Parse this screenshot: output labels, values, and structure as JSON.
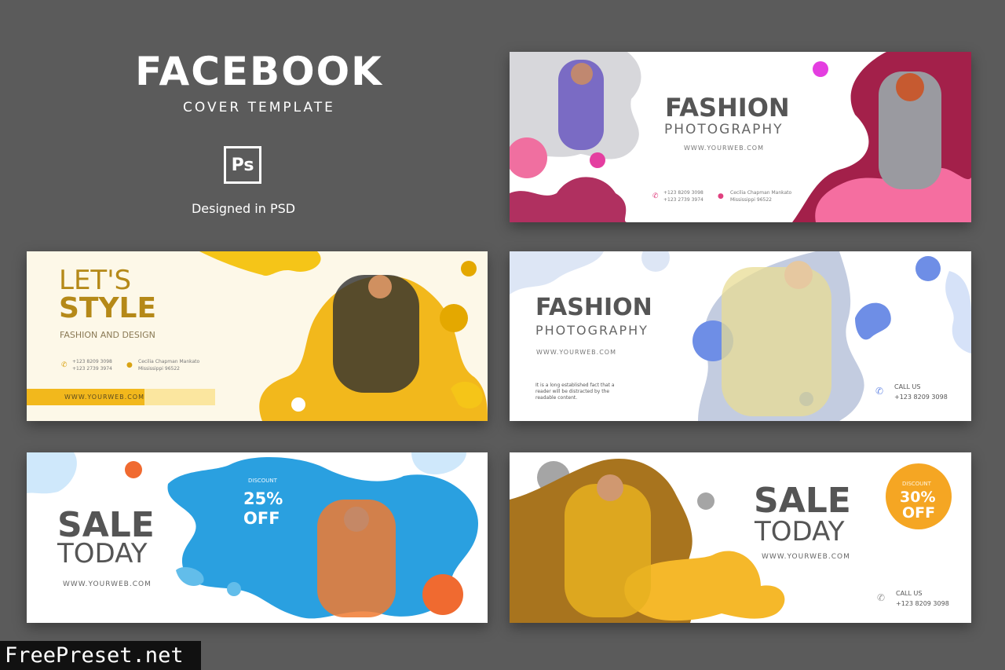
{
  "header": {
    "title": "FACEBOOK",
    "subtitle": "COVER TEMPLATE",
    "ps_label": "Ps",
    "note": "Designed in PSD"
  },
  "cards": {
    "fashion1": {
      "title": "FASHION",
      "subtitle": "PHOTOGRAPHY",
      "url": "WWW.YOURWEB.COM",
      "phone1": "+123 8209 3098",
      "phone2": "+123 2739 3974",
      "addr1": "Cecilia Chapman Mankato",
      "addr2": "Mississippi 96522",
      "accent": "#e0407f"
    },
    "style": {
      "line1": "LET'S",
      "line2": "STYLE",
      "tagline": "FASHION AND DESIGN",
      "phone1": "+123 8209 3098",
      "phone2": "+123 2739 3974",
      "addr1": "Cecilia Chapman Mankato",
      "addr2": "Mississippi 96522",
      "url": "WWW.YOURWEB.COM",
      "accent": "#f2b81c"
    },
    "fashion2": {
      "title": "FASHION",
      "subtitle": "PHOTOGRAPHY",
      "url": "WWW.YOURWEB.COM",
      "body1": "It is a long established fact that a",
      "body2": "reader will be distracted by the",
      "body3": "readable content.",
      "call_label": "CALL US",
      "call_number": "+123 8209 3098",
      "accent": "#6e8ee6"
    },
    "sale1": {
      "line1": "SALE",
      "line2": "TODAY",
      "url": "WWW.YOURWEB.COM",
      "discount_label": "DISCOUNT",
      "discount_value": "25%",
      "discount_off": "OFF",
      "accent": "#2aa0e0"
    },
    "sale2": {
      "line1": "SALE",
      "line2": "TODAY",
      "url": "WWW.YOURWEB.COM",
      "discount_label": "DISCOUNT",
      "discount_value": "30%",
      "discount_off": "OFF",
      "call_label": "CALL US",
      "call_number": "+123 8209 3098",
      "accent": "#f5a623"
    }
  },
  "watermark": "FreePreset.net"
}
